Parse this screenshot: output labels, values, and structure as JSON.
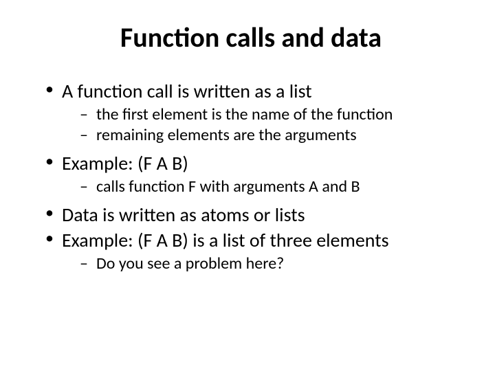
{
  "title": "Function calls and data",
  "bullets": {
    "b1": "A function call is written as a list",
    "b1_subs": {
      "s1": "the first element is the name of the function",
      "s2": "remaining elements are the arguments"
    },
    "b2_prefix": "Example: ",
    "b2_code": "(F A B)",
    "b2_subs": {
      "s1_a": "calls function ",
      "s1_b": "F",
      "s1_c": " with arguments ",
      "s1_d": "A",
      "s1_e": " and ",
      "s1_f": "B"
    },
    "b3": "Data is written as atoms or lists",
    "b4_prefix": "Example: ",
    "b4_code": "(F A B)",
    "b4_suffix": " is a list of three elements",
    "b4_subs": {
      "s1": "Do you see a problem here?"
    }
  }
}
